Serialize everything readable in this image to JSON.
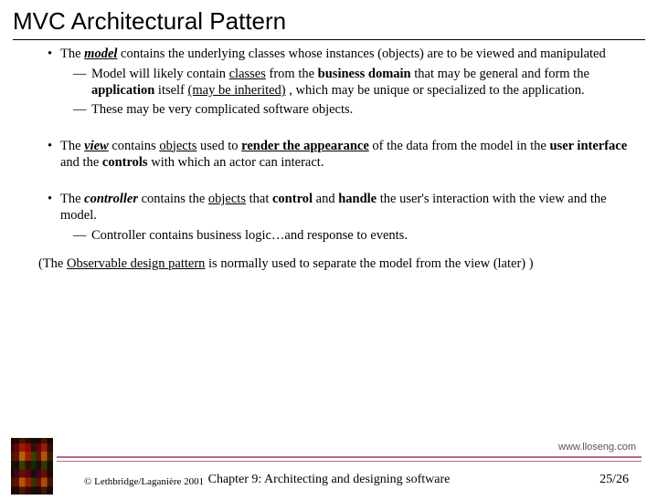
{
  "title": "MVC Architectural Pattern",
  "bullets": {
    "model": {
      "pre": "The ",
      "term": "model",
      "post": " contains the underlying classes whose instances (objects) are to be viewed and manipulated",
      "sub1_html": "Model will likely contain <span class='u'>classes</span> from the <span class='b'>business domain</span> that may be general and form the <span class='b'>application</span> itself <span class='u'>(may be inherited)</span> , which may be unique or specialized to the application.",
      "sub2": "These may be very complicated software objects."
    },
    "view": {
      "html": "The <span class='bi u'>view</span> contains <span class='u'>objects</span> used to <span class='b u'>render the appearance</span> of the data from the model in the <span class='b'>user interface</span> and the <span class='b'>controls</span> with which an actor can interact."
    },
    "controller": {
      "html": "The <span class='bi'>controller</span> contains the <span class='u'>objects</span> that <span class='b'>control</span> and <span class='b'>handle</span> the user's interaction with the view and the model.",
      "sub1": "Controller contains business logic…and response to events."
    }
  },
  "note_html": "(The <span class='u'>Observable design pattern</span> is normally used to separate the model from the view   (later) )",
  "footer": {
    "url": "www.lloseng.com",
    "copyright": "© Lethbridge/Laganière 2001",
    "chapter": "Chapter 9: Architecting and designing software",
    "page": "25/26"
  }
}
